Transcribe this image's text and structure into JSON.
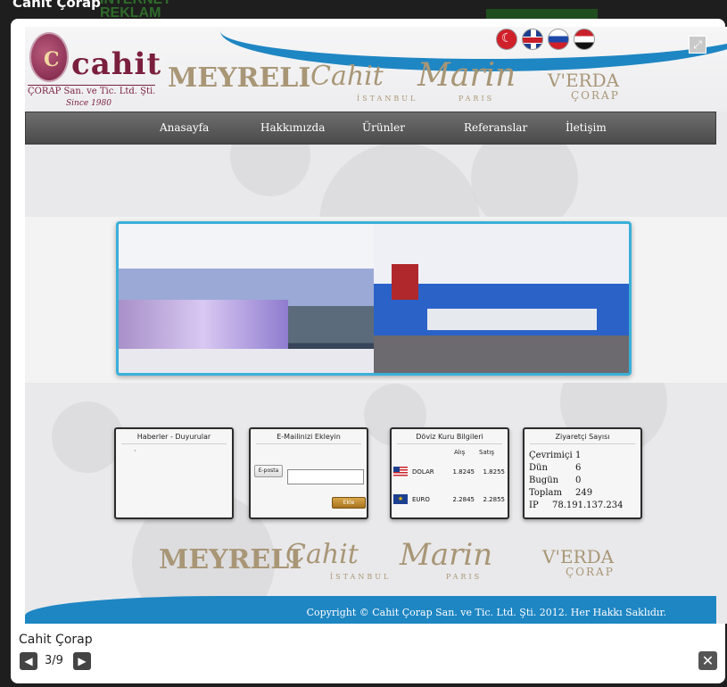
{
  "background": {
    "page_title": "Cahit Çorap",
    "ad_text": "INTERNET REKLAM"
  },
  "lightbox": {
    "caption": "Cahit Çorap",
    "counter": "3/9",
    "prev_icon": "◀",
    "next_icon": "▶",
    "close_icon": "✕",
    "expand_icon": "⤢"
  },
  "site": {
    "logo": {
      "letter": "C",
      "name": "cahit",
      "subtitle": "ÇORAP San. ve Tic. Ltd. Şti.",
      "since": "Since 1980"
    },
    "brands": {
      "meyreli": "MEYRELI",
      "cahit_main": "Cahit",
      "cahit_sub": "İSTANBUL",
      "marin_main": "Marin",
      "marin_sub": "PARIS",
      "verda_main": "V'ERDA",
      "verda_sub": "ÇORAP"
    },
    "nav": [
      "Anasayfa",
      "Hakkımızda",
      "Ürünler",
      "Referanslar",
      "İletişim"
    ],
    "news": {
      "title": "Haberler - Duyurular",
      "bullet": "·"
    },
    "email": {
      "title": "E-Mailinizi Ekleyin",
      "label": "E-posta",
      "value": "",
      "button": "Ekle"
    },
    "currency": {
      "title": "Döviz Kuru Bilgileri",
      "buy_header": "Alış",
      "sell_header": "Satış",
      "rows": [
        {
          "name": "DOLAR",
          "buy": "1.8245",
          "sell": "1.8255"
        },
        {
          "name": "EURO",
          "buy": "2.2845",
          "sell": "2.2855"
        }
      ],
      "eu_stars": "★"
    },
    "visitors": {
      "title": "Ziyaretçi Sayısı",
      "rows": [
        {
          "label": "Çevrimiçi",
          "value": "1"
        },
        {
          "label": "Dün",
          "value": "6"
        },
        {
          "label": "Bugün",
          "value": "0"
        },
        {
          "label": "Toplam",
          "value": "249"
        },
        {
          "label": "IP",
          "value": "78.191.137.234"
        }
      ]
    },
    "copyright": "Copyright © Cahit Çorap San. ve Tic. Ltd. Şti. 2012. Her Hakkı Saklıdır."
  },
  "colors": {
    "accent_blue": "#1e86c3",
    "logo_maroon": "#7a1f3d",
    "brand_gold": "#a89676",
    "nav_dark": "#4a4a4a"
  }
}
